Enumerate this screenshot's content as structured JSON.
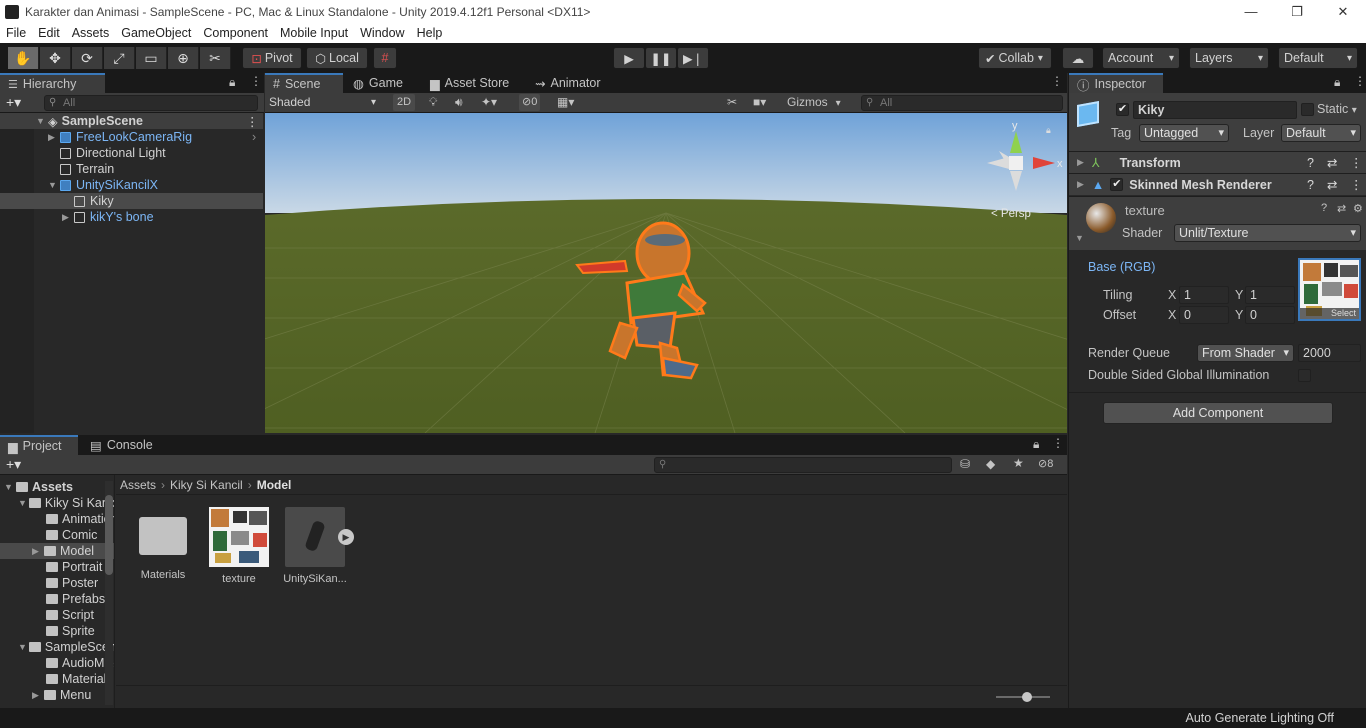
{
  "window": {
    "title": "Karakter dan Animasi - SampleScene - PC, Mac & Linux Standalone - Unity 2019.4.12f1 Personal <DX11>",
    "minimize": "—",
    "maximize": "❐",
    "close": "✕"
  },
  "menu": [
    "File",
    "Edit",
    "Assets",
    "GameObject",
    "Component",
    "Mobile Input",
    "Window",
    "Help"
  ],
  "toolbar": {
    "pivot": "Pivot",
    "local": "Local",
    "collab": "Collab",
    "account": "Account",
    "layers": "Layers",
    "layout": "Default"
  },
  "hierarchy": {
    "tab": "Hierarchy",
    "search_placeholder": "All",
    "scene": "SampleScene",
    "items": [
      {
        "label": "FreeLookCameraRig"
      },
      {
        "label": "Directional Light"
      },
      {
        "label": "Terrain"
      },
      {
        "label": "UnitySiKancilX"
      },
      {
        "label": "Kiky"
      },
      {
        "label": "kikY's bone"
      }
    ]
  },
  "scene_view": {
    "tabs": [
      "Scene",
      "Game",
      "Asset Store",
      "Animator"
    ],
    "draw_mode": "Shaded",
    "mode_2d": "2D",
    "hidden_count": "0",
    "gizmos": "Gizmos",
    "search_placeholder": "All",
    "persp": "< Persp",
    "gizmo_axes": {
      "y": "y",
      "x": "x"
    }
  },
  "inspector": {
    "tab": "Inspector",
    "object_name": "Kiky",
    "static": "Static",
    "tag_label": "Tag",
    "tag": "Untagged",
    "layer_label": "Layer",
    "layer": "Default",
    "components": [
      "Transform",
      "Skinned Mesh Renderer"
    ],
    "material": {
      "name": "texture",
      "shader_label": "Shader",
      "shader": "Unlit/Texture",
      "base": "Base (RGB)",
      "tiling_label": "Tiling",
      "offset_label": "Offset",
      "tiling": {
        "x": "1",
        "y": "1"
      },
      "offset": {
        "x": "0",
        "y": "0"
      },
      "x_label": "X",
      "y_label": "Y",
      "select": "Select",
      "render_queue_label": "Render Queue",
      "render_queue_mode": "From Shader",
      "render_queue": "2000",
      "double_sided": "Double Sided Global Illumination"
    },
    "add_component": "Add Component"
  },
  "project": {
    "tabs": [
      "Project",
      "Console"
    ],
    "hidden_count": "8",
    "breadcrumb": [
      "Assets",
      "Kiky Si Kancil",
      "Model"
    ],
    "tree": [
      {
        "label": "Assets"
      },
      {
        "label": "Kiky Si Kancil"
      },
      {
        "label": "Animation"
      },
      {
        "label": "Comic"
      },
      {
        "label": "Model"
      },
      {
        "label": "Portrait"
      },
      {
        "label": "Poster"
      },
      {
        "label": "Prefabs"
      },
      {
        "label": "Script"
      },
      {
        "label": "Sprite"
      },
      {
        "label": "SampleScene"
      },
      {
        "label": "AudioMixer"
      },
      {
        "label": "Materials"
      },
      {
        "label": "Menu"
      }
    ],
    "assets": [
      {
        "label": "Materials"
      },
      {
        "label": "texture"
      },
      {
        "label": "UnitySiKan..."
      }
    ]
  },
  "statusbar": {
    "text": "Auto Generate Lighting Off"
  },
  "colors": {
    "accent": "#3a79bb",
    "selection_orange": "#ff7a1a",
    "link_blue": "#7cb6f5"
  }
}
